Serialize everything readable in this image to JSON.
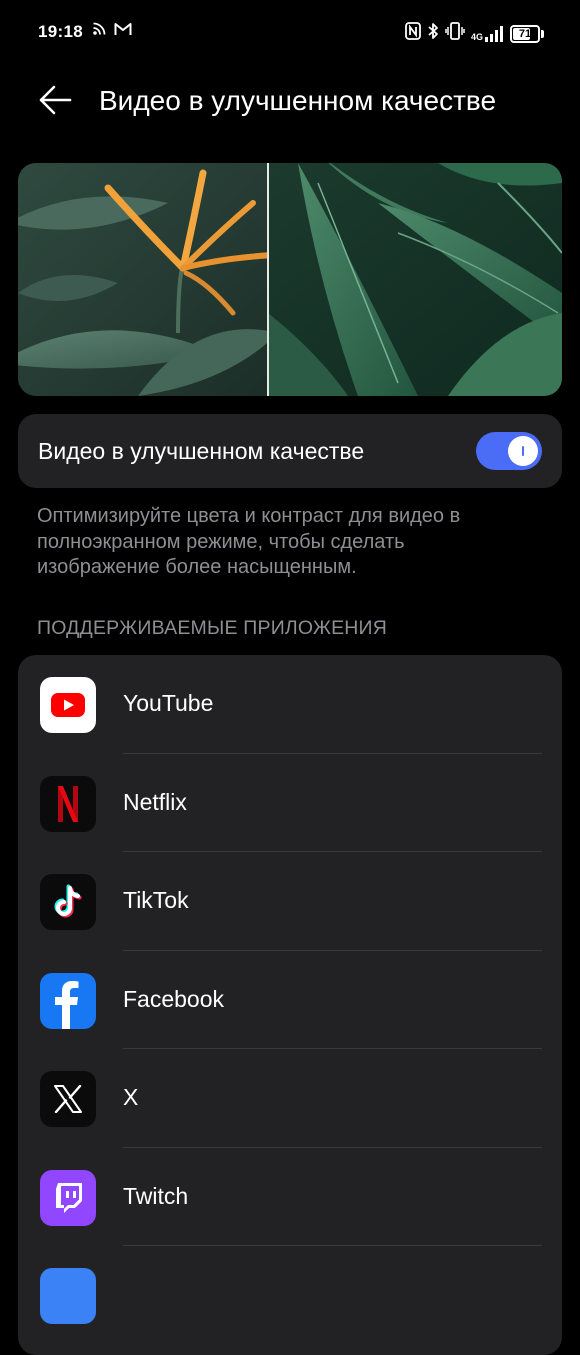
{
  "status_bar": {
    "time": "19:18",
    "battery_level": "71",
    "battery_fraction": 0.71,
    "network_label": "4G",
    "icons": [
      "rss-feed-icon",
      "gmail-icon",
      "nfc-icon",
      "bluetooth-icon",
      "vibrate-icon",
      "signal-icon",
      "battery-icon"
    ]
  },
  "header": {
    "back_icon": "arrow-left-icon",
    "title": "Видео в улучшенном качестве"
  },
  "preview": {
    "description_icon": "comparison-image"
  },
  "toggle": {
    "label": "Видео в улучшенном качестве",
    "enabled": true
  },
  "description": "Оптимизируйте цвета и контраст для видео в полноэкранном режиме, чтобы сделать изображение более насыщенным.",
  "supported_apps": {
    "header": "ПОДДЕРЖИВАЕМЫЕ ПРИЛОЖЕНИЯ",
    "items": [
      {
        "name": "YouTube",
        "icon": "youtube-icon"
      },
      {
        "name": "Netflix",
        "icon": "netflix-icon"
      },
      {
        "name": "TikTok",
        "icon": "tiktok-icon"
      },
      {
        "name": "Facebook",
        "icon": "facebook-icon"
      },
      {
        "name": "X",
        "icon": "x-icon"
      },
      {
        "name": "Twitch",
        "icon": "twitch-icon"
      }
    ]
  },
  "colors": {
    "background": "#000000",
    "card": "#222224",
    "accent": "#4a6cf7",
    "secondary_text": "#8e8e93",
    "youtube": "#ff0000",
    "netflix": "#e50914",
    "facebook": "#1877f2",
    "twitch": "#9146ff"
  }
}
